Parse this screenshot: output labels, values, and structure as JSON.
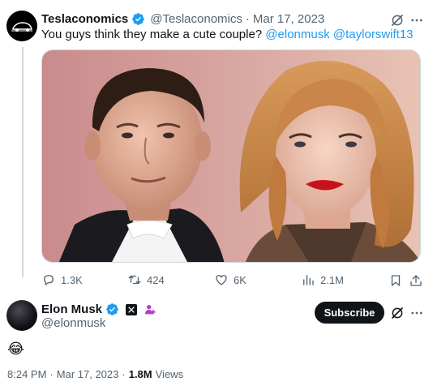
{
  "quoted_tweet": {
    "author_name": "Teslaconomics",
    "author_handle": "@Teslaconomics",
    "separator": "·",
    "date": "Mar 17, 2023",
    "text_prefix": "You guys think they make a cute couple?",
    "mention1": "@elonmusk",
    "mention2": "@taylorswift13",
    "stats": {
      "replies": "1.3K",
      "retweets": "424",
      "likes": "6K",
      "views": "2.1M"
    }
  },
  "main_tweet": {
    "author_name": "Elon Musk",
    "author_handle": "@elonmusk",
    "subscribe_label": "Subscribe",
    "text": "😂",
    "time": "8:24 PM",
    "separator": "·",
    "date": "Mar 17, 2023",
    "separator2": "·",
    "views_count": "1.8M",
    "views_label": "Views"
  },
  "icons": {
    "verified": "verified-badge-icon",
    "grok": "grok-icon",
    "more": "more-icon",
    "reply": "reply-icon",
    "retweet": "retweet-icon",
    "like": "like-icon",
    "views": "views-icon",
    "bookmark": "bookmark-icon",
    "share": "share-icon",
    "x_logo": "x-logo-icon",
    "affiliate": "affiliate-icon"
  },
  "colors": {
    "accent": "#1d9bf0",
    "muted": "#536471",
    "text": "#0f1419",
    "affiliate": "#b43bd0"
  }
}
